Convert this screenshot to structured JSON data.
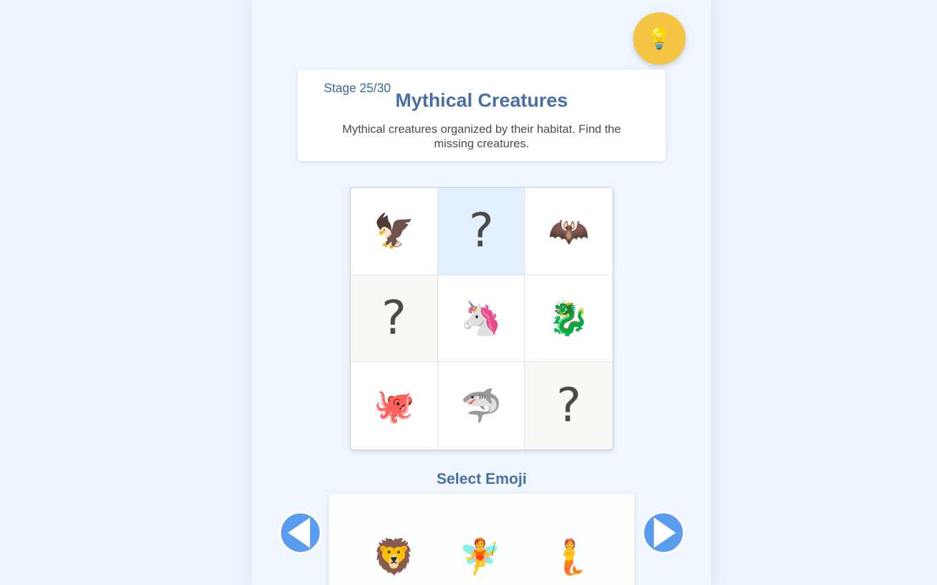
{
  "hint": {
    "icon": "💡",
    "icon_name": "lightbulb-icon"
  },
  "header": {
    "stage": "Stage 25/30",
    "title": "Mythical Creatures",
    "description": "Mythical creatures organized by their habitat. Find the missing creatures."
  },
  "grid": {
    "cells": [
      {
        "value": "🦅",
        "name": "eagle"
      },
      {
        "value": "?",
        "name": "missing"
      },
      {
        "value": "🦇",
        "name": "bat"
      },
      {
        "value": "?",
        "name": "missing"
      },
      {
        "value": "🦄",
        "name": "unicorn"
      },
      {
        "value": "🐉",
        "name": "dragon"
      },
      {
        "value": "🐙",
        "name": "octopus"
      },
      {
        "value": "🦈",
        "name": "shark"
      },
      {
        "value": "?",
        "name": "missing"
      }
    ]
  },
  "selector": {
    "title": "Select Emoji",
    "options": [
      {
        "value": "🦁",
        "name": "lion"
      },
      {
        "value": "🧚",
        "name": "fairy"
      },
      {
        "value": "🧜",
        "name": "merperson"
      }
    ]
  },
  "colors": {
    "accent": "#4870a6",
    "hint": "#f6c443",
    "arrow": "#5a9df0",
    "active_cell": "#e1efff"
  }
}
